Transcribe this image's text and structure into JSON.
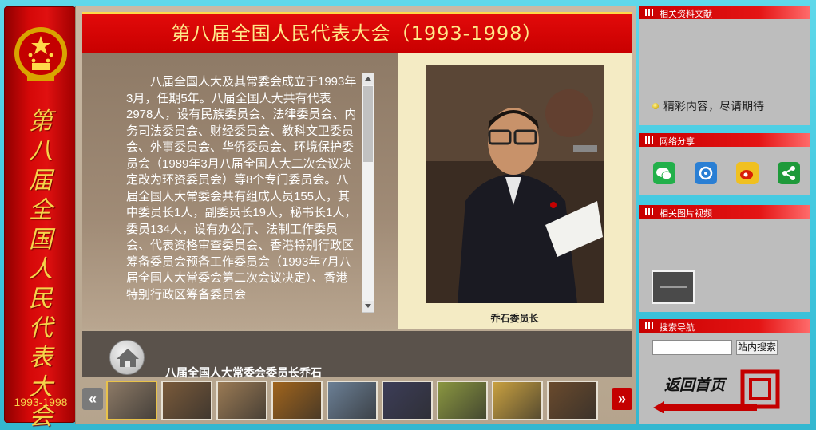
{
  "banner": {
    "vertical_title": "第八届全国人民代表大会",
    "years": "1993-1998"
  },
  "main": {
    "title": "第八届全国人民代表大会（1993-1998）",
    "body_text": "八届全国人大及其常委会成立于1993年3月，任期5年。八届全国人大共有代表2978人，设有民族委员会、法律委员会、内务司法委员会、财经委员会、教科文卫委员会、外事委员会、华侨委员会、环境保护委员会（1989年3月八届全国人大二次会议决定改为环资委员会）等8个专门委员会。八届全国人大常委会共有组成人员155人，其中委员长1人，副委员长19人，秘书长1人，委员134人，设有办公厅、法制工作委员会、代表资格审查委员会、香港特别行政区筹备委员会预备工作委员会（1993年7月八届全国人大常委会第二次会议决定）、香港特别行政区筹备委员会",
    "photo_caption": "乔石委员长",
    "subtitle": "八届全国人大常委会委员长乔石"
  },
  "thumbnails": [
    {
      "color": "#8d7a66"
    },
    {
      "color": "#7a5a3a"
    },
    {
      "color": "#9a7a54"
    },
    {
      "color": "#a0641c"
    },
    {
      "color": "#6b7f95"
    },
    {
      "color": "#3c3d58"
    },
    {
      "color": "#8a9640"
    },
    {
      "color": "#c8a040"
    },
    {
      "color": "#6a4a2c"
    },
    {
      "color": "#e8e0d0"
    }
  ],
  "sidebar": {
    "literature_title": "相关资料文献",
    "literature_item": "精彩内容，尽请期待",
    "share_title": "网络分享",
    "share_icons": [
      {
        "name": "wechat-icon",
        "color": "#22b04a"
      },
      {
        "name": "qq-icon",
        "color": "#2a7fd4"
      },
      {
        "name": "weibo-icon",
        "color": "#f0c020"
      },
      {
        "name": "share-icon",
        "color": "#1e9a3a"
      }
    ],
    "video_title": "相关图片视频",
    "search_title": "搜索导航",
    "search_button": "站内搜索",
    "back_home": "返回首页"
  }
}
